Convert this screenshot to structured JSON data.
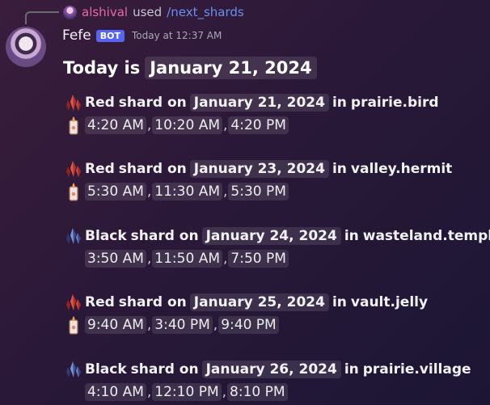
{
  "reply": {
    "user": "alshival",
    "used": "used",
    "command": "/next_shards"
  },
  "message": {
    "author": "Fefe",
    "bot_tag": "BOT",
    "timestamp": "Today at 12:37 AM"
  },
  "today": {
    "prefix": "Today is",
    "date": "January 21, 2024"
  },
  "shards": [
    {
      "color": "Red",
      "icon": "red-shard-icon",
      "on": "shard on",
      "date": "January 21, 2024",
      "in": "in",
      "location": "prairie.bird",
      "has_candle": true,
      "candle_icon": "candle-icon",
      "times": [
        "4:20 AM",
        "10:20 AM",
        "4:20 PM"
      ]
    },
    {
      "color": "Red",
      "icon": "red-shard-icon",
      "on": "shard on",
      "date": "January 23, 2024",
      "in": "in",
      "location": "valley.hermit",
      "has_candle": true,
      "candle_icon": "candle-icon",
      "times": [
        "5:30 AM",
        "11:30 AM",
        "5:30 PM"
      ]
    },
    {
      "color": "Black",
      "icon": "black-shard-icon",
      "on": "shard on",
      "date": "January 24, 2024",
      "in": "in",
      "location": "wasteland.temple",
      "has_candle": false,
      "times": [
        "3:50 AM",
        "11:50 AM",
        "7:50 PM"
      ]
    },
    {
      "color": "Red",
      "icon": "red-shard-icon",
      "on": "shard on",
      "date": "January 25, 2024",
      "in": "in",
      "location": "vault.jelly",
      "has_candle": true,
      "candle_icon": "candle-icon",
      "times": [
        "9:40 AM",
        "3:40 PM",
        "9:40 PM"
      ]
    },
    {
      "color": "Black",
      "icon": "black-shard-icon",
      "on": "shard on",
      "date": "January 26, 2024",
      "in": "in",
      "location": "prairie.village",
      "has_candle": false,
      "times": [
        "4:10 AM",
        "12:10 PM",
        "8:10 PM"
      ]
    }
  ],
  "colors": {
    "red_shard": "#c0392b",
    "black_shard": "#3f5fae",
    "bot_tag": "#5865f2",
    "reply_user": "#e86aa4",
    "command": "#6b8ff0"
  }
}
